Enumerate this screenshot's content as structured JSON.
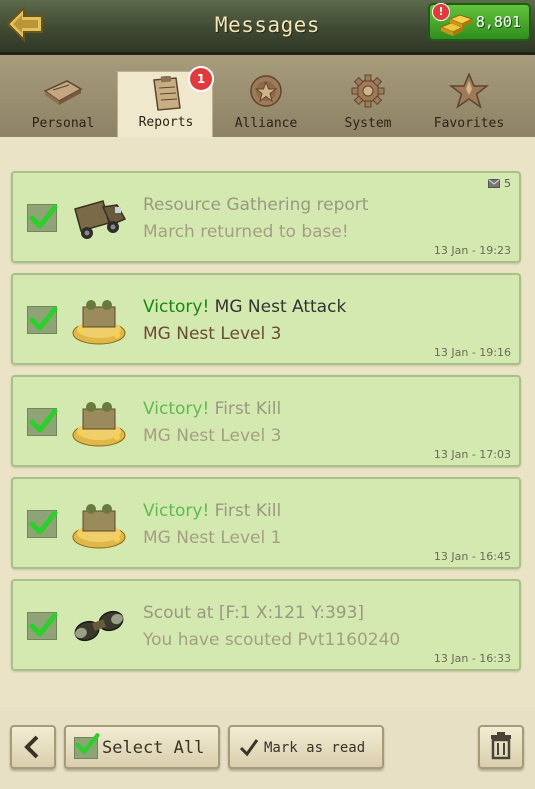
{
  "header": {
    "title": "Messages",
    "gold_amount": "8,801",
    "gold_badge": "!"
  },
  "tabs": [
    {
      "label": "Personal",
      "icon": "folder-icon"
    },
    {
      "label": "Reports",
      "icon": "clipboard-icon",
      "badge": "1",
      "active": true
    },
    {
      "label": "Alliance",
      "icon": "alliance-emblem-icon"
    },
    {
      "label": "System",
      "icon": "gear-icon"
    },
    {
      "label": "Favorites",
      "icon": "star-icon"
    }
  ],
  "messages": [
    {
      "victory": "",
      "title": "Resource Gathering report",
      "subtitle": "March returned to base!",
      "date": "13 Jan - 19:23",
      "count": "5",
      "icon": "truck-icon",
      "unread": false
    },
    {
      "victory": "Victory!",
      "title": " MG Nest Attack",
      "subtitle": "MG Nest Level 3",
      "date": "13 Jan - 19:16",
      "icon": "bunker-loot-icon",
      "unread": true
    },
    {
      "victory": "Victory!",
      "title": " First Kill",
      "subtitle": "MG Nest Level 3",
      "date": "13 Jan - 17:03",
      "icon": "bunker-loot-icon",
      "unread": false
    },
    {
      "victory": "Victory!",
      "title": " First Kill",
      "subtitle": "MG Nest Level 1",
      "date": "13 Jan - 16:45",
      "icon": "bunker-loot-icon",
      "unread": false
    },
    {
      "victory": "",
      "title": "Scout at [F:1  X:121  Y:393]",
      "subtitle": "You have scouted Pvt1160240",
      "date": "13 Jan - 16:33",
      "icon": "binoculars-icon",
      "unread": false
    }
  ],
  "footer": {
    "select_all": "Select All",
    "mark_as_read": "Mark as read"
  },
  "colors": {
    "card_bg": "#d4e9b0",
    "victory_green": "#158a0e",
    "header_bg": "#3f4a33"
  }
}
